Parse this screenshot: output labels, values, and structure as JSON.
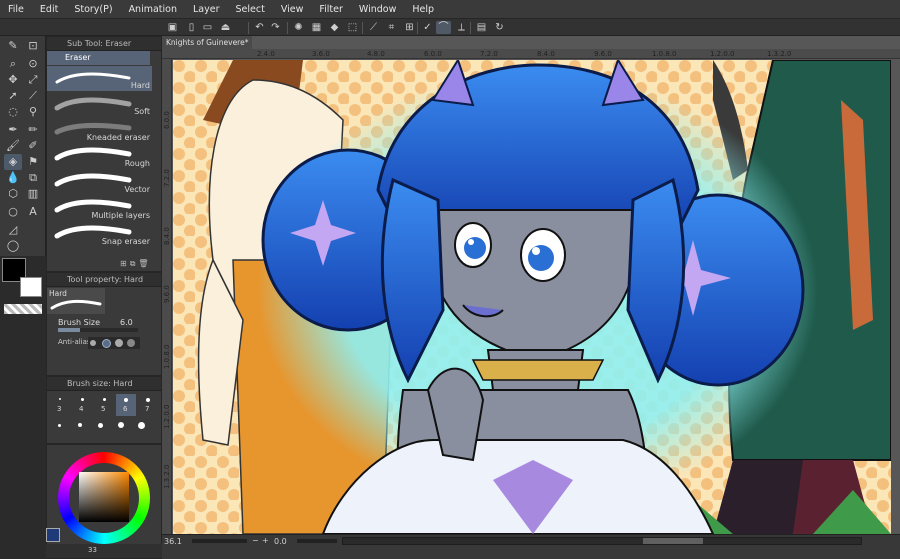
{
  "menu": [
    "File",
    "Edit",
    "Story(P)",
    "Animation",
    "Layer",
    "Select",
    "View",
    "Filter",
    "Window",
    "Help"
  ],
  "icons": {
    "new": "document-icon",
    "open": "folder-icon",
    "save": "save-icon",
    "undo": "undo-icon",
    "redo": "redo-icon",
    "loading": "spinner-icon",
    "clear": "clear-icon",
    "fill": "fill-icon",
    "transform": "transform-icon",
    "snap_ruler": "ruler-snap-icon",
    "snap_special": "special-ruler-snap-icon",
    "snap_grid": "grid-snap-icon",
    "stabilize": "stabilizer-icon",
    "lasso": "lasso-icon",
    "selection": "selection-icon"
  },
  "sub_tool": {
    "title": "Sub Tool: Eraser",
    "group": "Eraser",
    "items": [
      "Hard",
      "Soft",
      "Kneaded eraser",
      "Rough",
      "Vector",
      "Multiple layers",
      "Snap eraser"
    ],
    "selected": "Hard"
  },
  "tool_property": {
    "title": "Tool property: Hard",
    "preset": "Hard",
    "brush_size_label": "Brush Size",
    "brush_size_value": "6.0",
    "antialias_label": "Anti-alias"
  },
  "brush_size_panel": {
    "title": "Brush size: Hard",
    "sizes": [
      "3",
      "4",
      "5",
      "6",
      "7"
    ],
    "selected": "6"
  },
  "document": {
    "tab_title": "Knights of Guinevere*",
    "zoom": "36.1",
    "rotation": "0.0",
    "footer_value": "33"
  },
  "ruler_top": [
    "2.4.0",
    "3.6.0",
    "4.8.0",
    "6.0.0",
    "7.2.0",
    "8.4.0",
    "9.6.0",
    "1.0.8.0",
    "1.2.0.0",
    "1.3.2.0"
  ],
  "ruler_left": [
    "6.0.0",
    "7.2.0",
    "8.4.0",
    "9.6.0",
    "1.0.8.0",
    "1.2.0.0",
    "1.3.2.0"
  ],
  "colors": {
    "ui_bg": "#3a3a3a",
    "hair": "#1f5fd1",
    "hair_light": "#3b8cf0",
    "skin_gray": "#8a8fa0",
    "glow": "#7fe6f0",
    "bg_yellow": "#f7d9a0",
    "dots": "#f0b86a",
    "jacket": "#1f5a4b",
    "pants_orange": "#e3942d"
  }
}
